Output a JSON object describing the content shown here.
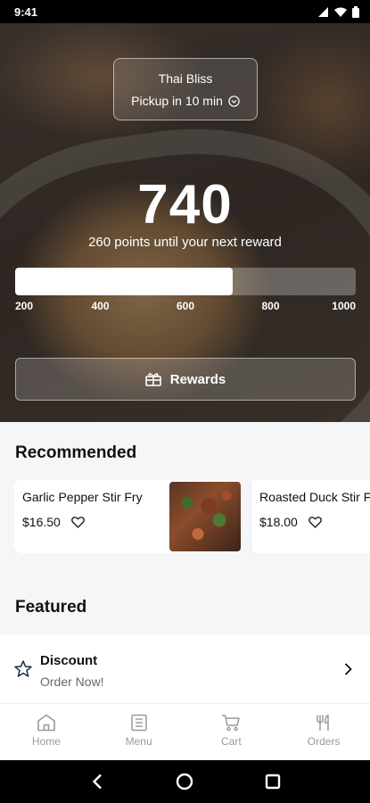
{
  "status_bar": {
    "time": "9:41"
  },
  "store": {
    "name": "Thai Bliss",
    "pickup": "Pickup in 10 min"
  },
  "points": {
    "value": "740",
    "subtitle": "260 points until your next reward",
    "progress_fraction": 0.64,
    "ticks": [
      "200",
      "400",
      "600",
      "800",
      "1000"
    ]
  },
  "rewards_button": {
    "label": "Rewards"
  },
  "recommended": {
    "title": "Recommended",
    "items": [
      {
        "name": "Garlic Pepper Stir Fry",
        "price": "$16.50"
      },
      {
        "name": "Roasted Duck Stir Fry",
        "price": "$18.00"
      }
    ]
  },
  "featured": {
    "title": "Featured",
    "items": [
      {
        "name": "Discount",
        "subtitle": "Order Now!"
      }
    ]
  },
  "nav": {
    "items": [
      {
        "label": "Home",
        "active": true
      },
      {
        "label": "Menu",
        "active": false
      },
      {
        "label": "Cart",
        "active": false
      },
      {
        "label": "Orders",
        "active": false
      }
    ],
    "accent_color": "#f08a24",
    "inactive_color": "#9a9a9a"
  }
}
